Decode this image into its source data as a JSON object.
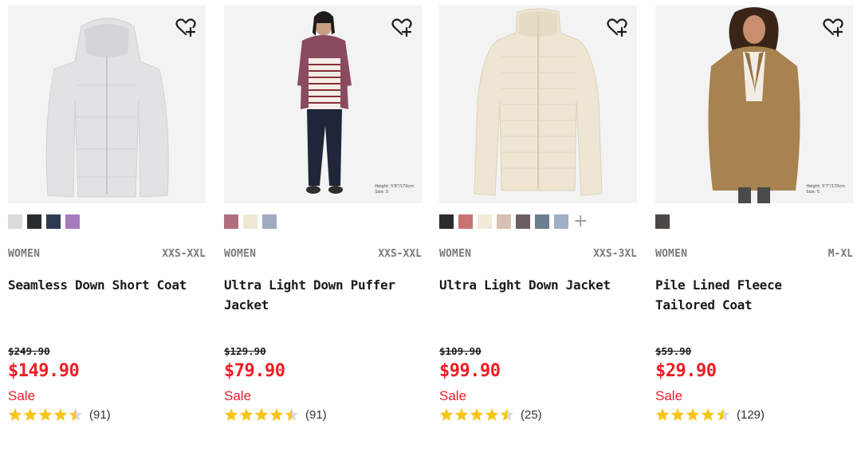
{
  "products": [
    {
      "gender": "WOMEN",
      "size_range": "XXS-XXL",
      "name": "Seamless Down Short Coat",
      "original_price": "$249.90",
      "sale_price": "$149.90",
      "sale_label": "Sale",
      "rating": 4.5,
      "review_count": "(91)",
      "swatches": [
        "#dcdcdc",
        "#2a2b2d",
        "#2f3a52",
        "#a77bbf"
      ],
      "more_colors": false,
      "photo_note": []
    },
    {
      "gender": "WOMEN",
      "size_range": "XXS-XXL",
      "name": "Ultra Light Down Puffer Jacket",
      "original_price": "$129.90",
      "sale_price": "$79.90",
      "sale_label": "Sale",
      "rating": 4.5,
      "review_count": "(91)",
      "swatches": [
        "#b06f7f",
        "#eee7d4",
        "#9eabc1"
      ],
      "more_colors": false,
      "photo_note": [
        "Height: 5'8\"/172cm",
        "Size: S"
      ]
    },
    {
      "gender": "WOMEN",
      "size_range": "XXS-3XL",
      "name": "Ultra Light Down Jacket",
      "original_price": "$109.90",
      "sale_price": "$99.90",
      "sale_label": "Sale",
      "rating": 4.5,
      "review_count": "(25)",
      "swatches": [
        "#2b2b2e",
        "#c87272",
        "#f1ead7",
        "#d6c0b4",
        "#6c5e5e",
        "#6b7e8e",
        "#9eaec5"
      ],
      "more_colors": true,
      "more_symbol": "+",
      "photo_note": []
    },
    {
      "gender": "WOMEN",
      "size_range": "M-XL",
      "name": "Pile Lined Fleece Tailored Coat",
      "original_price": "$59.90",
      "sale_price": "$29.90",
      "sale_label": "Sale",
      "rating": 4.5,
      "review_count": "(129)",
      "swatches": [
        "#4a4745"
      ],
      "more_colors": false,
      "photo_note": [
        "Height: 5'7\"/170cm",
        "Size: S"
      ]
    }
  ],
  "colors": {
    "sale_red": "#ed1d24",
    "star_gold": "#f5c518",
    "muted_gray": "#7a7a7a"
  },
  "icons": {
    "favorite": "heart-plus-icon",
    "rating": "star-icon"
  }
}
